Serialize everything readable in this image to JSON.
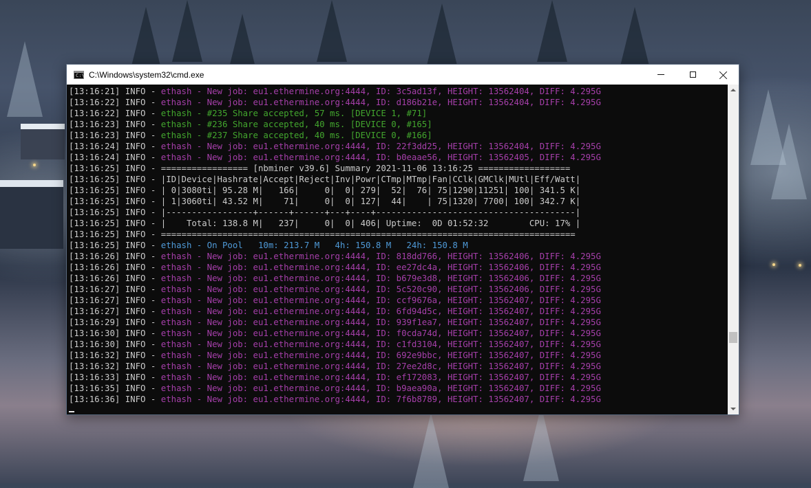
{
  "window": {
    "title": "C:\\Windows\\system32\\cmd.exe",
    "icon_label": "C:\\"
  },
  "controls": {
    "minimize": "minimize-icon",
    "maximize": "maximize-icon",
    "close": "close-icon"
  },
  "colors": {
    "info": "#cccccc",
    "new_job": "#a63faa",
    "share_accepted": "#43a72e",
    "pool_status": "#4f9ad8"
  },
  "console": {
    "lines": [
      {
        "prefix": "[13:16:21] INFO - ",
        "message": "ethash - New job: eu1.ethermine.org:4444, ID: 3c5ad13f, HEIGHT: 13562404, DIFF: 4.295G",
        "color": "magenta"
      },
      {
        "prefix": "[13:16:22] INFO - ",
        "message": "ethash - New job: eu1.ethermine.org:4444, ID: d186b21e, HEIGHT: 13562404, DIFF: 4.295G",
        "color": "magenta"
      },
      {
        "prefix": "[13:16:22] INFO - ",
        "message": "ethash - #235 Share accepted, 57 ms. [DEVICE 1, #71]",
        "color": "green"
      },
      {
        "prefix": "[13:16:23] INFO - ",
        "message": "ethash - #236 Share accepted, 40 ms. [DEVICE 0, #165]",
        "color": "green"
      },
      {
        "prefix": "[13:16:23] INFO - ",
        "message": "ethash - #237 Share accepted, 40 ms. [DEVICE 0, #166]",
        "color": "green"
      },
      {
        "prefix": "[13:16:24] INFO - ",
        "message": "ethash - New job: eu1.ethermine.org:4444, ID: 22f3dd25, HEIGHT: 13562404, DIFF: 4.295G",
        "color": "magenta"
      },
      {
        "prefix": "[13:16:24] INFO - ",
        "message": "ethash - New job: eu1.ethermine.org:4444, ID: b0eaae56, HEIGHT: 13562405, DIFF: 4.295G",
        "color": "magenta"
      },
      {
        "prefix": "[13:16:25] INFO - ",
        "message": "================= [nbminer v39.6] Summary 2021-11-06 13:16:25 ==================",
        "color": "gray"
      },
      {
        "prefix": "[13:16:25] INFO - ",
        "message": "|ID|Device|Hashrate|Accept|Reject|Inv|Powr|CTmp|MTmp|Fan|CClk|GMClk|MUtl|Eff/Watt|",
        "color": "gray"
      },
      {
        "prefix": "[13:16:25] INFO - ",
        "message": "| 0|3080ti| 95.28 M|   166|     0|  0| 279|  52|  76| 75|1290|11251| 100| 341.5 K|",
        "color": "gray"
      },
      {
        "prefix": "[13:16:25] INFO - ",
        "message": "| 1|3060ti| 43.52 M|    71|     0|  0| 127|  44|    | 75|1320| 7700| 100| 342.7 K|",
        "color": "gray"
      },
      {
        "prefix": "[13:16:25] INFO - ",
        "message": "|-----------------+------+------+---+----+---------------------------------------|",
        "color": "gray"
      },
      {
        "prefix": "[13:16:25] INFO - ",
        "message": "|    Total: 138.8 M|   237|     0|  0| 406| Uptime:  0D 01:52:32        CPU: 17% |",
        "color": "gray"
      },
      {
        "prefix": "[13:16:25] INFO - ",
        "message": "=================================================================================",
        "color": "gray"
      },
      {
        "prefix": "[13:16:25] INFO - ",
        "message": "ethash - On Pool   10m: 213.7 M   4h: 150.8 M   24h: 150.8 M",
        "color": "blue"
      },
      {
        "prefix": "[13:16:26] INFO - ",
        "message": "ethash - New job: eu1.ethermine.org:4444, ID: 818dd766, HEIGHT: 13562406, DIFF: 4.295G",
        "color": "magenta"
      },
      {
        "prefix": "[13:16:26] INFO - ",
        "message": "ethash - New job: eu1.ethermine.org:4444, ID: ee27dc4a, HEIGHT: 13562406, DIFF: 4.295G",
        "color": "magenta"
      },
      {
        "prefix": "[13:16:26] INFO - ",
        "message": "ethash - New job: eu1.ethermine.org:4444, ID: b679e3d8, HEIGHT: 13562406, DIFF: 4.295G",
        "color": "magenta"
      },
      {
        "prefix": "[13:16:27] INFO - ",
        "message": "ethash - New job: eu1.ethermine.org:4444, ID: 5c520c90, HEIGHT: 13562406, DIFF: 4.295G",
        "color": "magenta"
      },
      {
        "prefix": "[13:16:27] INFO - ",
        "message": "ethash - New job: eu1.ethermine.org:4444, ID: ccf9676a, HEIGHT: 13562407, DIFF: 4.295G",
        "color": "magenta"
      },
      {
        "prefix": "[13:16:27] INFO - ",
        "message": "ethash - New job: eu1.ethermine.org:4444, ID: 6fd94d5c, HEIGHT: 13562407, DIFF: 4.295G",
        "color": "magenta"
      },
      {
        "prefix": "[13:16:29] INFO - ",
        "message": "ethash - New job: eu1.ethermine.org:4444, ID: 939f1ea7, HEIGHT: 13562407, DIFF: 4.295G",
        "color": "magenta"
      },
      {
        "prefix": "[13:16:30] INFO - ",
        "message": "ethash - New job: eu1.ethermine.org:4444, ID: f0cda74d, HEIGHT: 13562407, DIFF: 4.295G",
        "color": "magenta"
      },
      {
        "prefix": "[13:16:30] INFO - ",
        "message": "ethash - New job: eu1.ethermine.org:4444, ID: c1fd3104, HEIGHT: 13562407, DIFF: 4.295G",
        "color": "magenta"
      },
      {
        "prefix": "[13:16:32] INFO - ",
        "message": "ethash - New job: eu1.ethermine.org:4444, ID: 692e9bbc, HEIGHT: 13562407, DIFF: 4.295G",
        "color": "magenta"
      },
      {
        "prefix": "[13:16:32] INFO - ",
        "message": "ethash - New job: eu1.ethermine.org:4444, ID: 27ee2d8c, HEIGHT: 13562407, DIFF: 4.295G",
        "color": "magenta"
      },
      {
        "prefix": "[13:16:33] INFO - ",
        "message": "ethash - New job: eu1.ethermine.org:4444, ID: ef172083, HEIGHT: 13562407, DIFF: 4.295G",
        "color": "magenta"
      },
      {
        "prefix": "[13:16:35] INFO - ",
        "message": "ethash - New job: eu1.ethermine.org:4444, ID: b9aea90a, HEIGHT: 13562407, DIFF: 4.295G",
        "color": "magenta"
      },
      {
        "prefix": "[13:16:36] INFO - ",
        "message": "ethash - New job: eu1.ethermine.org:4444, ID: 7f6b8789, HEIGHT: 13562407, DIFF: 4.295G",
        "color": "magenta"
      }
    ]
  }
}
